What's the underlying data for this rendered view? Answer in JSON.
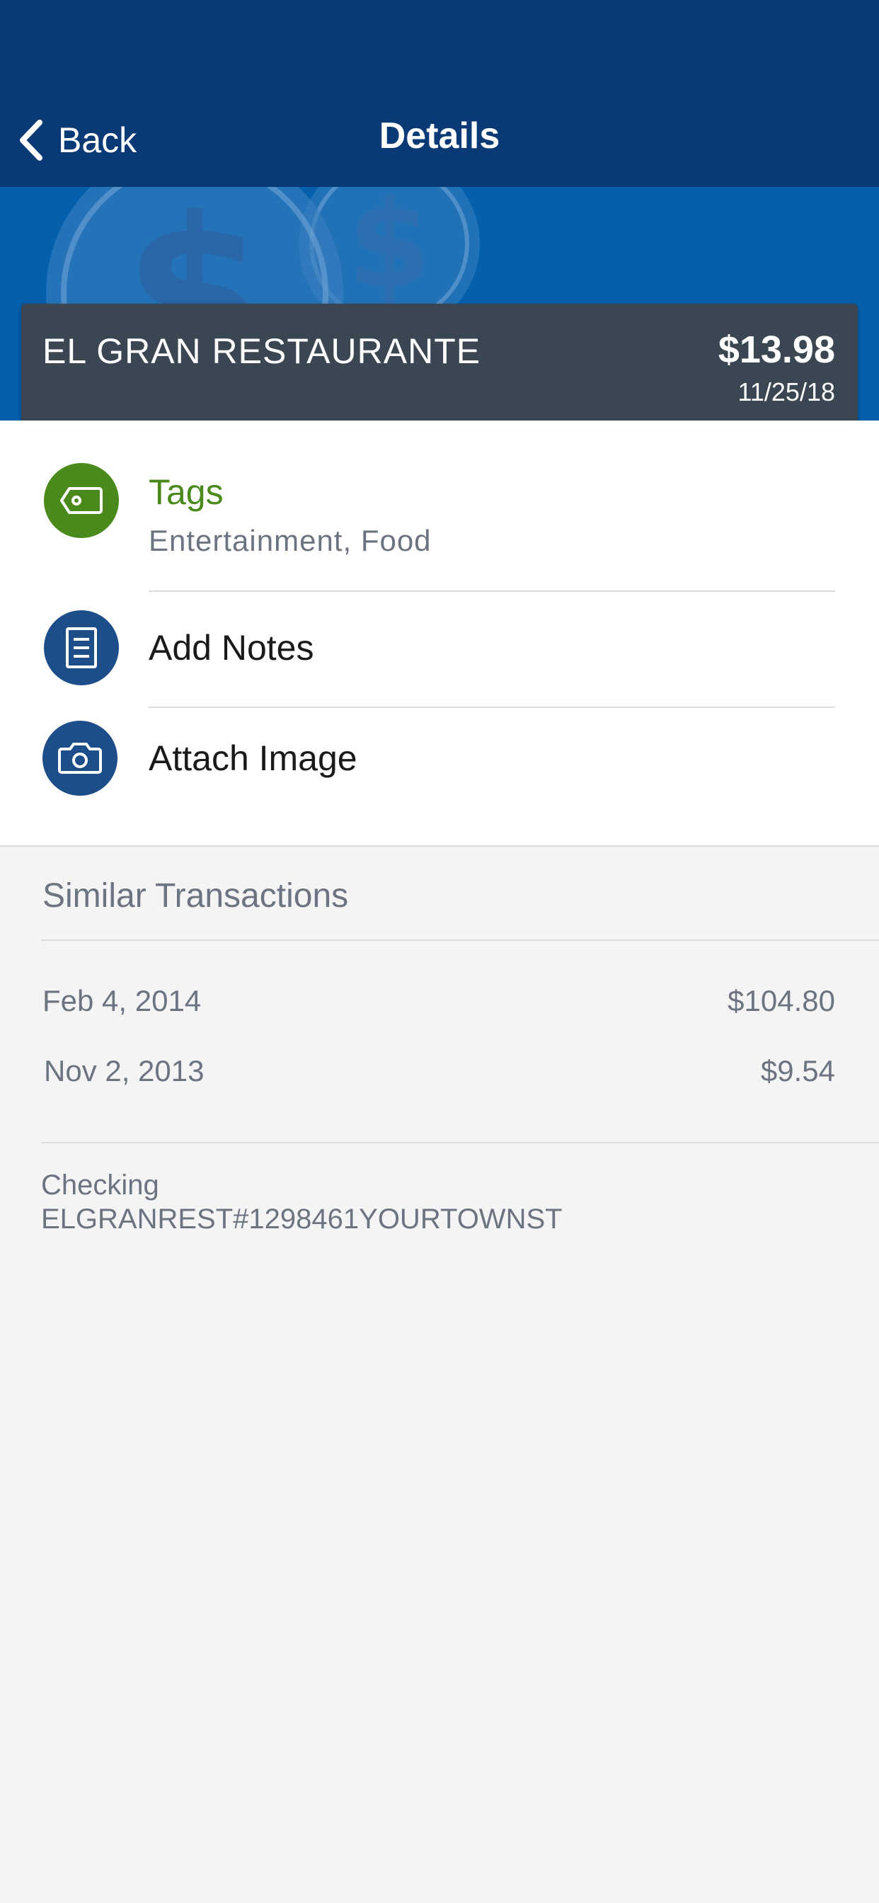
{
  "nav": {
    "back_label": "Back",
    "title": "Details"
  },
  "transaction": {
    "merchant": "EL GRAN RESTAURANTE",
    "amount": "$13.98",
    "date": "11/25/18"
  },
  "actions": {
    "tags": {
      "title": "Tags",
      "subtitle": "Entertainment, Food",
      "icon": "tag-icon",
      "color": "#4a8a1c"
    },
    "notes": {
      "title": "Add Notes",
      "icon": "notes-icon",
      "color": "#1d4e8a"
    },
    "image": {
      "title": "Attach Image",
      "icon": "camera-icon",
      "color": "#1d4e8a"
    }
  },
  "similar": {
    "heading": "Similar Transactions",
    "items": [
      {
        "date": "Feb 4, 2014",
        "amount": "$104.80"
      },
      {
        "date": "Nov 2, 2013",
        "amount": "$9.54"
      }
    ]
  },
  "account": {
    "type": "Checking",
    "description": "ELGRANREST#1298461YOURTOWNST"
  },
  "colors": {
    "navbar": "#0a3a76",
    "hero": "#0460ad",
    "card": "#3a4753",
    "background": "#f4f4f5"
  }
}
